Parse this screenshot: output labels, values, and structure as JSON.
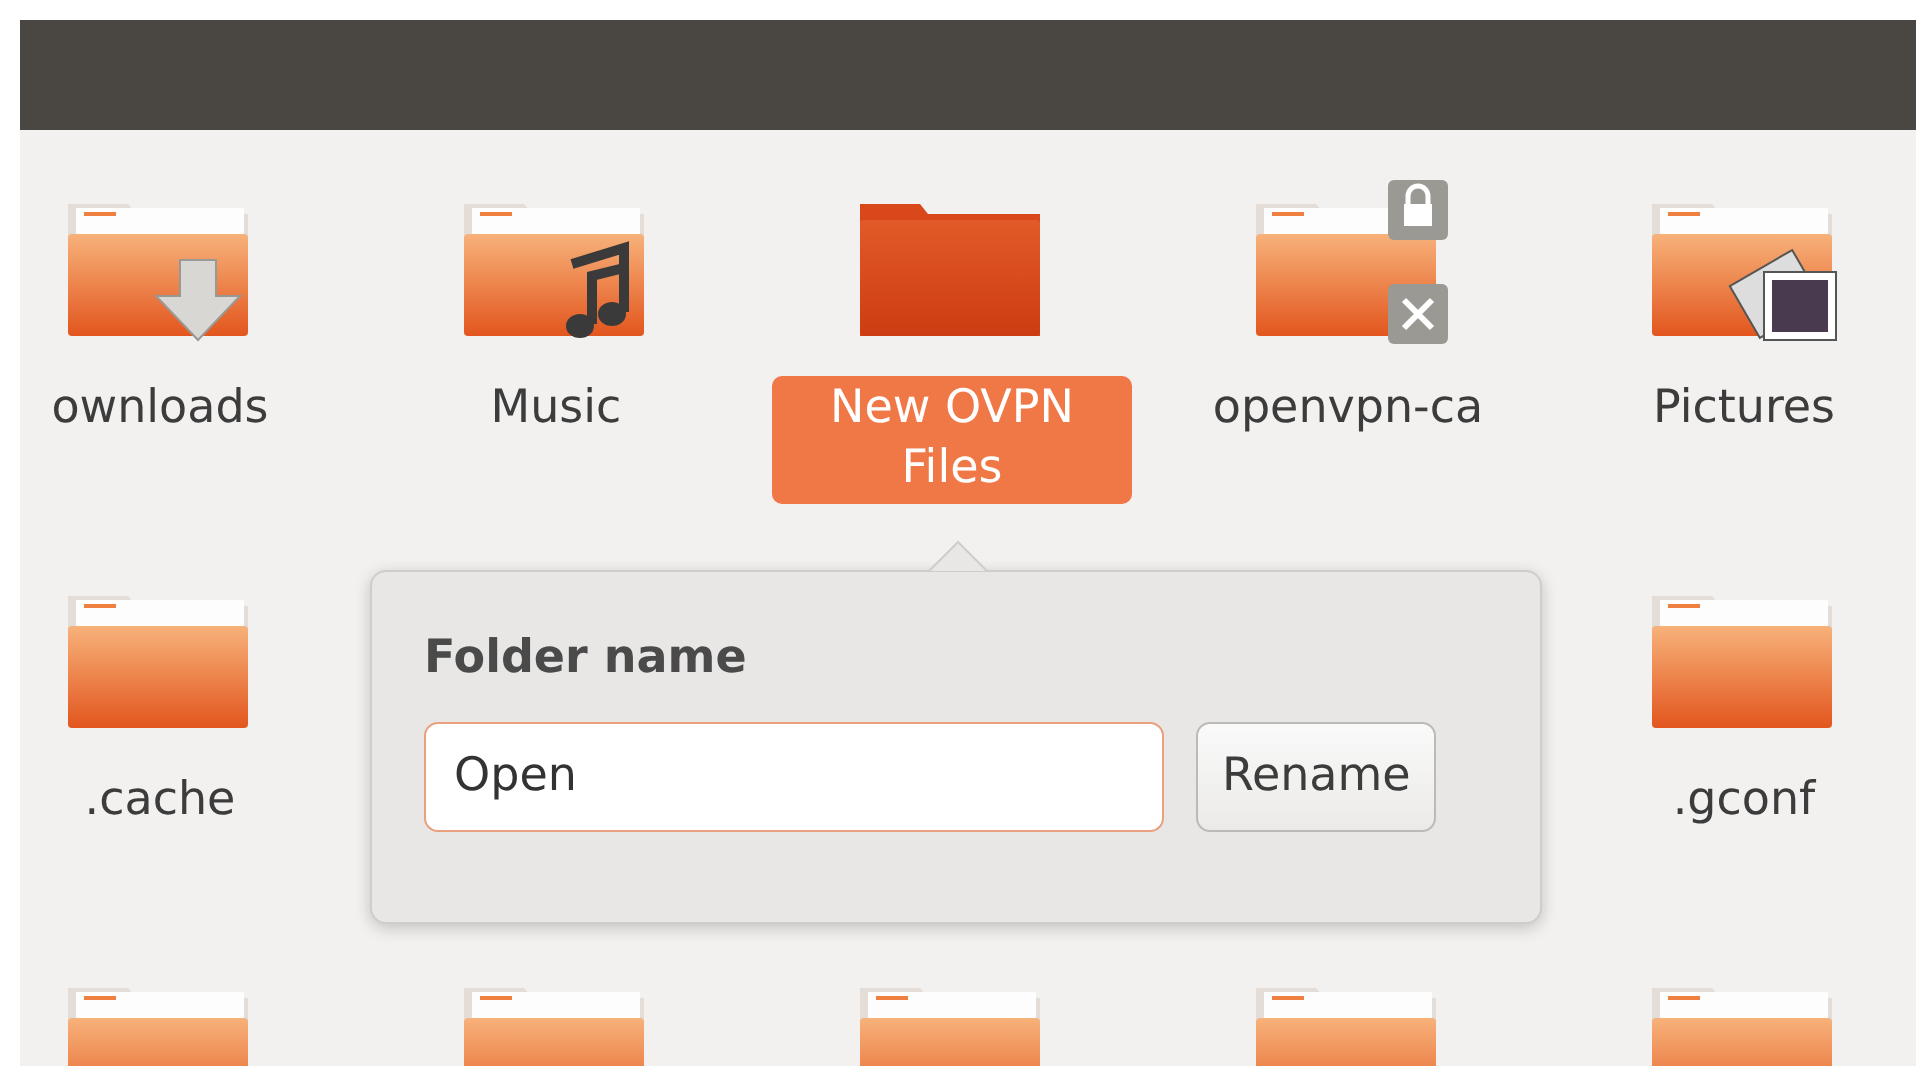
{
  "rows": [
    [
      {
        "name": "ownloads",
        "kind": "downloads",
        "selected": false
      },
      {
        "name": "Music",
        "kind": "music",
        "selected": false
      },
      {
        "name": "New OVPN Files",
        "kind": "folder",
        "selected": true
      },
      {
        "name": "openvpn-ca",
        "kind": "locked",
        "selected": false
      },
      {
        "name": "Pictures",
        "kind": "pictures",
        "selected": false
      }
    ],
    [
      {
        "name": ".cache",
        "kind": "folder",
        "selected": false
      },
      {
        "name": ".gconf",
        "kind": "folder",
        "selected": false
      }
    ],
    [
      {
        "kind": "folder",
        "selected": false
      },
      {
        "kind": "folder",
        "selected": false
      },
      {
        "kind": "folder",
        "selected": false
      },
      {
        "kind": "folder",
        "selected": false
      },
      {
        "kind": "folder",
        "selected": false
      }
    ]
  ],
  "rename_popover": {
    "title": "Folder name",
    "value": "Open",
    "button": "Rename"
  }
}
